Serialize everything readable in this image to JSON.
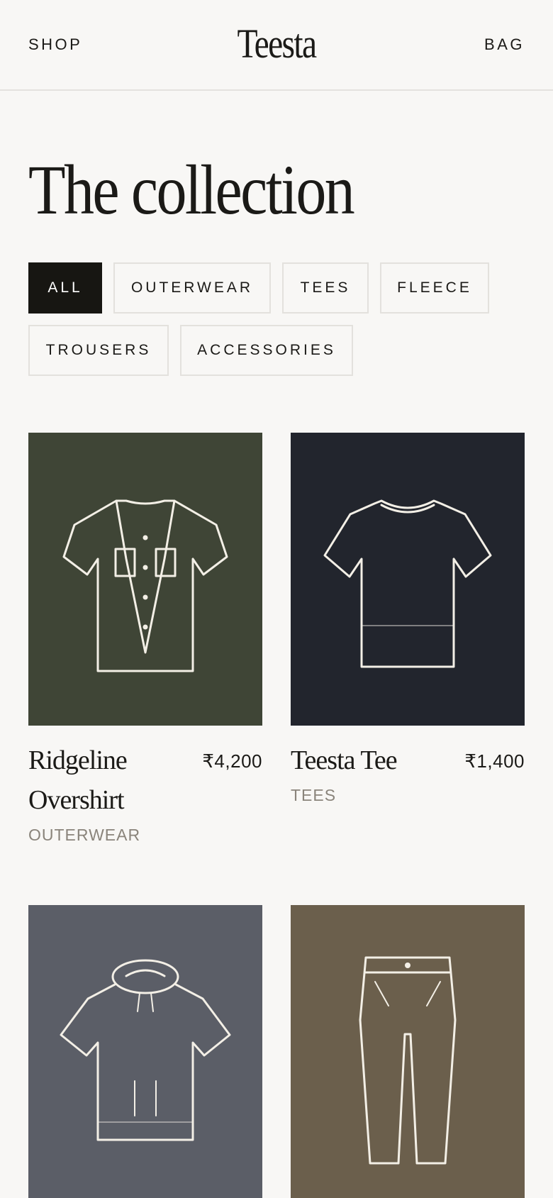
{
  "header": {
    "shop_label": "SHOP",
    "logo": "Teesta",
    "bag_label": "BAG"
  },
  "page": {
    "title": "The collection"
  },
  "filters": [
    {
      "label": "ALL",
      "active": true
    },
    {
      "label": "OUTERWEAR",
      "active": false
    },
    {
      "label": "TEES",
      "active": false
    },
    {
      "label": "FLEECE",
      "active": false
    },
    {
      "label": "TROUSERS",
      "active": false
    },
    {
      "label": "ACCESSORIES",
      "active": false
    }
  ],
  "products": [
    {
      "name": "Ridgeline Overshirt",
      "price": "₹4,200",
      "category": "OUTERWEAR",
      "icon": "overshirt-icon",
      "bg": "#3f4536"
    },
    {
      "name": "Teesta Tee",
      "price": "₹1,400",
      "category": "TEES",
      "icon": "tshirt-icon",
      "bg": "#22252d"
    },
    {
      "name": "",
      "price": "",
      "category": "",
      "icon": "hoodie-icon",
      "bg": "#5b5e67"
    },
    {
      "name": "",
      "price": "",
      "category": "",
      "icon": "trousers-icon",
      "bg": "#6b5f4c"
    }
  ],
  "colors": {
    "background": "#f8f7f5",
    "ink": "#1b1a17",
    "muted": "#8a847b",
    "line_art": "#f3efe6"
  }
}
